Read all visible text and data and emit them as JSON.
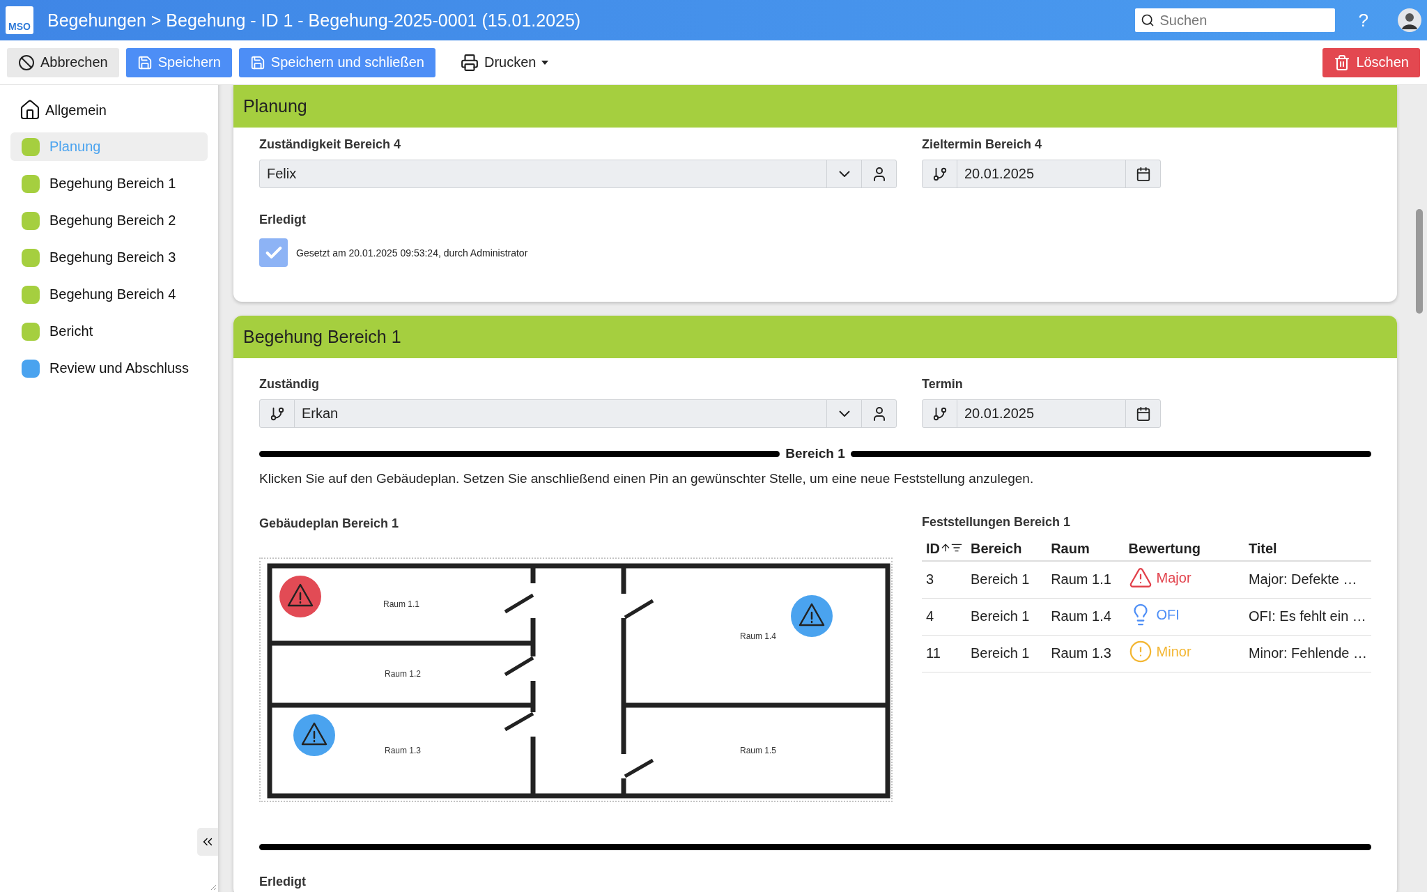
{
  "header": {
    "logo": "MSO",
    "title": "Begehungen > Begehung - ID 1 - Begehung-2025-0001 (15.01.2025)",
    "search": {
      "placeholder": "Suchen"
    },
    "help": "?"
  },
  "toolbar": {
    "cancel": "Abbrechen",
    "save": "Speichern",
    "save_close": "Speichern und schließen",
    "print": "Drucken",
    "delete": "Löschen"
  },
  "sidebar": {
    "home": "Allgemein",
    "items": [
      {
        "label": "Planung",
        "color": "#a5cf3f",
        "selected": true
      },
      {
        "label": "Begehung Bereich 1",
        "color": "#a5cf3f",
        "selected": false
      },
      {
        "label": "Begehung Bereich 2",
        "color": "#a5cf3f",
        "selected": false
      },
      {
        "label": "Begehung Bereich 3",
        "color": "#a5cf3f",
        "selected": false
      },
      {
        "label": "Begehung Bereich 4",
        "color": "#a5cf3f",
        "selected": false
      },
      {
        "label": "Bericht",
        "color": "#a5cf3f",
        "selected": false
      },
      {
        "label": "Review und Abschluss",
        "color": "#4aa3ef",
        "selected": false
      }
    ]
  },
  "planning": {
    "title": "Planung",
    "owner_label": "Zuständigkeit Bereich 4",
    "owner": "Felix",
    "date_label": "Zieltermin Bereich 4",
    "date": "20.01.2025",
    "done_label": "Erledigt",
    "done": {
      "checked": true,
      "note": "Gesetzt am 20.01.2025 09:53:24, durch Administrator"
    }
  },
  "area": {
    "title": "Begehung Bereich 1",
    "owner_label": "Zuständig",
    "owner": "Erkan",
    "date_label": "Termin",
    "date": "20.01.2025",
    "divider": "Bereich 1",
    "instruction": "Klicken Sie auf den Gebäudeplan. Setzen Sie anschließend einen Pin an gewünschter Stelle, um eine neue Feststellung anzulegen.",
    "plan_label": "Gebäudeplan Bereich 1",
    "rooms": [
      "Raum 1.1",
      "Raum 1.2",
      "Raum 1.3",
      "Raum 1.4",
      "Raum 1.5"
    ],
    "pins": [
      {
        "color": "#e24b55"
      },
      {
        "color": "#4aa3ef"
      },
      {
        "color": "#4aa3ef"
      }
    ],
    "findings_label": "Feststellungen Bereich 1",
    "columns": [
      "ID",
      "Bereich",
      "Raum",
      "Bewertung",
      "Titel"
    ],
    "rows": [
      {
        "id": "3",
        "area": "Bereich 1",
        "room": "Raum 1.1",
        "rating": {
          "kind": "major",
          "label": "Major"
        },
        "title": "Major: Defekte …"
      },
      {
        "id": "4",
        "area": "Bereich 1",
        "room": "Raum 1.4",
        "rating": {
          "kind": "ofi",
          "label": "OFI"
        },
        "title": "OFI: Es fehlt ein …"
      },
      {
        "id": "11",
        "area": "Bereich 1",
        "room": "Raum 1.3",
        "rating": {
          "kind": "minor",
          "label": "Minor"
        },
        "title": "Minor: Fehlende …"
      }
    ],
    "done_label": "Erledigt"
  }
}
